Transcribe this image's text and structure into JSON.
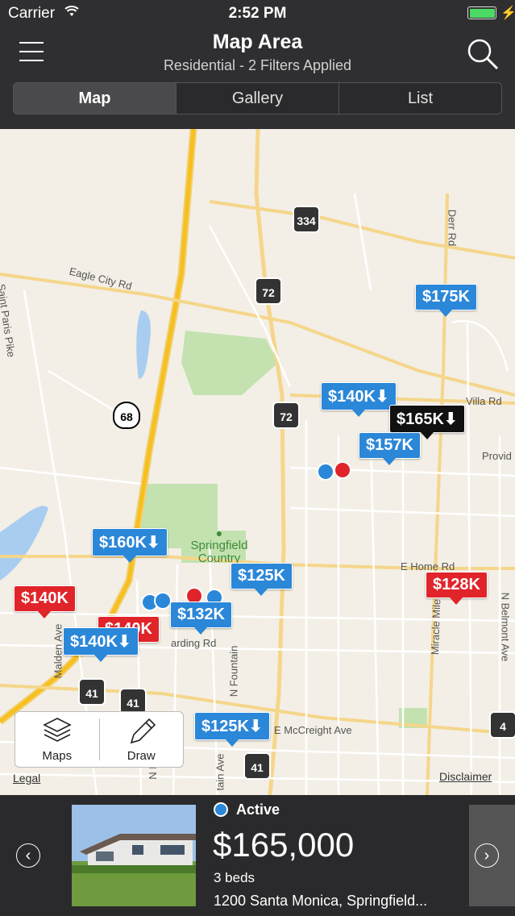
{
  "status_bar": {
    "carrier": "Carrier",
    "time": "2:52 PM"
  },
  "header": {
    "title": "Map Area",
    "subtitle": "Residential - 2 Filters Applied"
  },
  "tabs": [
    {
      "label": "Map",
      "active": true
    },
    {
      "label": "Gallery",
      "active": false
    },
    {
      "label": "List",
      "active": false
    }
  ],
  "map": {
    "streets": {
      "eagle_city": "Eagle City Rd",
      "saint_paris": "Saint Paris Pike",
      "derr": "Derr Rd",
      "villa": "Villa Rd",
      "provid": "Provid",
      "e_home": "E Home Rd",
      "miracle_mile": "Miracle Mile",
      "belmont": "N Belmont Ave",
      "fountain": "N Fountain",
      "mccreight": "E McCreight Ave",
      "plum": "N Plum St",
      "fountain_ave": "tain Ave",
      "malden": "Malden Ave",
      "harding": "arding Rd"
    },
    "shields": {
      "r334": "334",
      "r72a": "72",
      "r72b": "72",
      "r68": "68",
      "r41a": "41",
      "r41b": "41",
      "r41c": "41",
      "r4": "4"
    },
    "park": "Springfield\nCountry",
    "pins": [
      {
        "label": "$175K",
        "color": "blue"
      },
      {
        "label": "$140K⬇",
        "color": "blue"
      },
      {
        "label": "$165K⬇",
        "color": "black"
      },
      {
        "label": "$157K",
        "color": "blue"
      },
      {
        "label": "$160K⬇",
        "color": "blue"
      },
      {
        "label": "$125K",
        "color": "blue"
      },
      {
        "label": "$128K",
        "color": "red"
      },
      {
        "label": "$140K",
        "color": "red"
      },
      {
        "label": "$140K",
        "color": "red"
      },
      {
        "label": "$132K",
        "color": "blue"
      },
      {
        "label": "$140K⬇",
        "color": "blue"
      },
      {
        "label": "$125K⬇",
        "color": "blue"
      }
    ],
    "tools": {
      "maps": "Maps",
      "draw": "Draw"
    },
    "legal": "Legal",
    "disclaimer": "Disclaimer"
  },
  "listing": {
    "status": "Active",
    "price": "$165,000",
    "beds": "3 beds",
    "address": "1200 Santa Monica, Springfield..."
  },
  "colors": {
    "active_pin": "#2b87d8",
    "sold_pin": "#e0242a",
    "selected_pin": "#111111"
  }
}
